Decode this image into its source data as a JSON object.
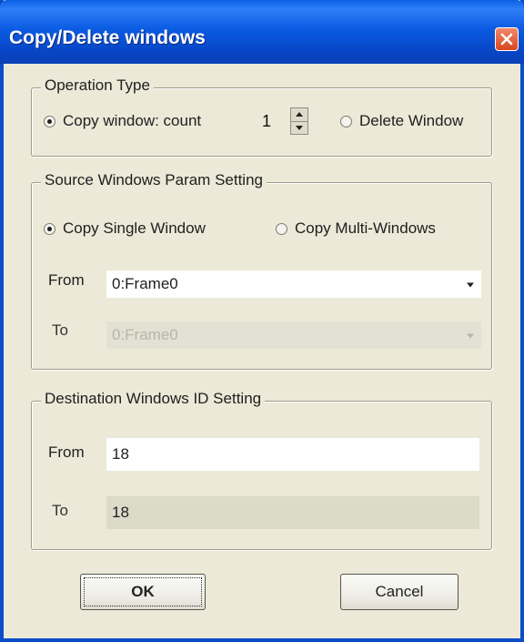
{
  "window": {
    "title": "Copy/Delete windows"
  },
  "operation_type": {
    "legend": "Operation Type",
    "copy_label": "Copy window: count",
    "count_value": "1",
    "delete_label": "Delete Window",
    "selected": "copy"
  },
  "source": {
    "legend": "Source Windows Param Setting",
    "single_label": "Copy Single Window",
    "multi_label": "Copy Multi-Windows",
    "selected": "single",
    "from_label": "From",
    "from_value": "0:Frame0",
    "to_label": "To",
    "to_value": "0:Frame0"
  },
  "destination": {
    "legend": "Destination Windows ID Setting",
    "from_label": "From",
    "from_value": "18",
    "to_label": "To",
    "to_value": "18"
  },
  "buttons": {
    "ok": "OK",
    "cancel": "Cancel"
  },
  "icons": {
    "close": "close-icon",
    "spin_up": "chevron-up-icon",
    "spin_down": "chevron-down-icon",
    "dropdown": "dropdown-arrow-icon"
  },
  "colors": {
    "titlebar": "#0b5ce3",
    "close": "#d9461f",
    "dialog_bg": "#ece9d8"
  }
}
